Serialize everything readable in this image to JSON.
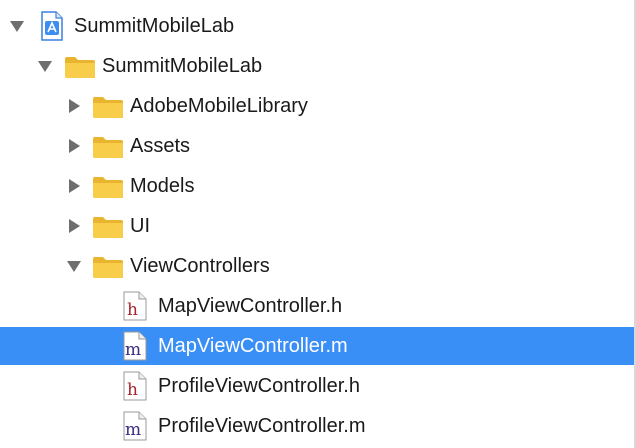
{
  "navigator": {
    "items": [
      {
        "label": "SummitMobileLab",
        "kind": "project",
        "icon": "xcode-project-icon",
        "expanded": true
      },
      {
        "label": "SummitMobileLab",
        "kind": "folder",
        "icon": "folder-icon",
        "expanded": true
      },
      {
        "label": "AdobeMobileLibrary",
        "kind": "folder",
        "icon": "folder-icon",
        "expanded": false
      },
      {
        "label": "Assets",
        "kind": "folder",
        "icon": "folder-icon",
        "expanded": false
      },
      {
        "label": "Models",
        "kind": "folder",
        "icon": "folder-icon",
        "expanded": false
      },
      {
        "label": "UI",
        "kind": "folder",
        "icon": "folder-icon",
        "expanded": false
      },
      {
        "label": "ViewControllers",
        "kind": "folder",
        "icon": "folder-icon",
        "expanded": true
      },
      {
        "label": "MapViewController.h",
        "kind": "header-file",
        "icon": "header-file-icon",
        "letter": "h"
      },
      {
        "label": "MapViewController.m",
        "kind": "implementation-file",
        "icon": "implementation-file-icon",
        "letter": "m",
        "selected": true
      },
      {
        "label": "ProfileViewController.h",
        "kind": "header-file",
        "icon": "header-file-icon",
        "letter": "h"
      },
      {
        "label": "ProfileViewController.m",
        "kind": "implementation-file",
        "icon": "implementation-file-icon",
        "letter": "m"
      }
    ]
  },
  "colors": {
    "selection": "#3a8ff6",
    "folder": "#f6c844",
    "header_letter": "#a3262b",
    "impl_letter": "#3c2a83",
    "disclosure": "#6e6e6e"
  }
}
